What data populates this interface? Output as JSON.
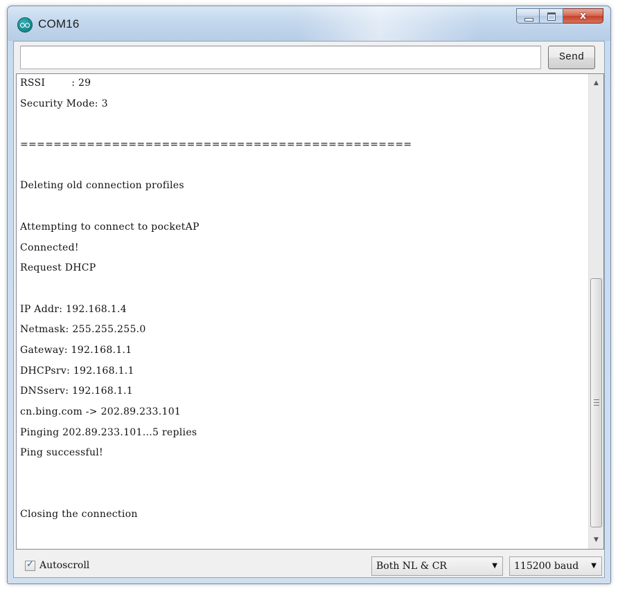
{
  "window": {
    "title": "COM16",
    "icon": "arduino-infinity-icon",
    "controls": {
      "minimize": "minimize-icon",
      "maximize": "maximize-icon",
      "close": "x"
    }
  },
  "send": {
    "input_value": "",
    "button_label": "Send"
  },
  "console": {
    "lines": [
      "RSSI        : 29",
      "Security Mode: 3",
      "",
      "===============================================",
      "",
      "Deleting old connection profiles",
      "",
      "Attempting to connect to pocketAP",
      "Connected!",
      "Request DHCP",
      "",
      "IP Addr: 192.168.1.4",
      "Netmask: 255.255.255.0",
      "Gateway: 192.168.1.1",
      "DHCPsrv: 192.168.1.1",
      "DNSserv: 192.168.1.1",
      "cn.bing.com -> 202.89.233.101",
      "Pinging 202.89.233.101...5 replies",
      "Ping successful!",
      "",
      "",
      "Closing the connection"
    ]
  },
  "footer": {
    "autoscroll": {
      "label": "Autoscroll",
      "checked": true
    },
    "line_ending": {
      "selected": "Both NL & CR"
    },
    "baud_rate": {
      "selected": "115200 baud"
    }
  },
  "colors": {
    "title_bar": "#c3d7ed",
    "close_button": "#c4412a",
    "app_icon": "#17858a"
  }
}
